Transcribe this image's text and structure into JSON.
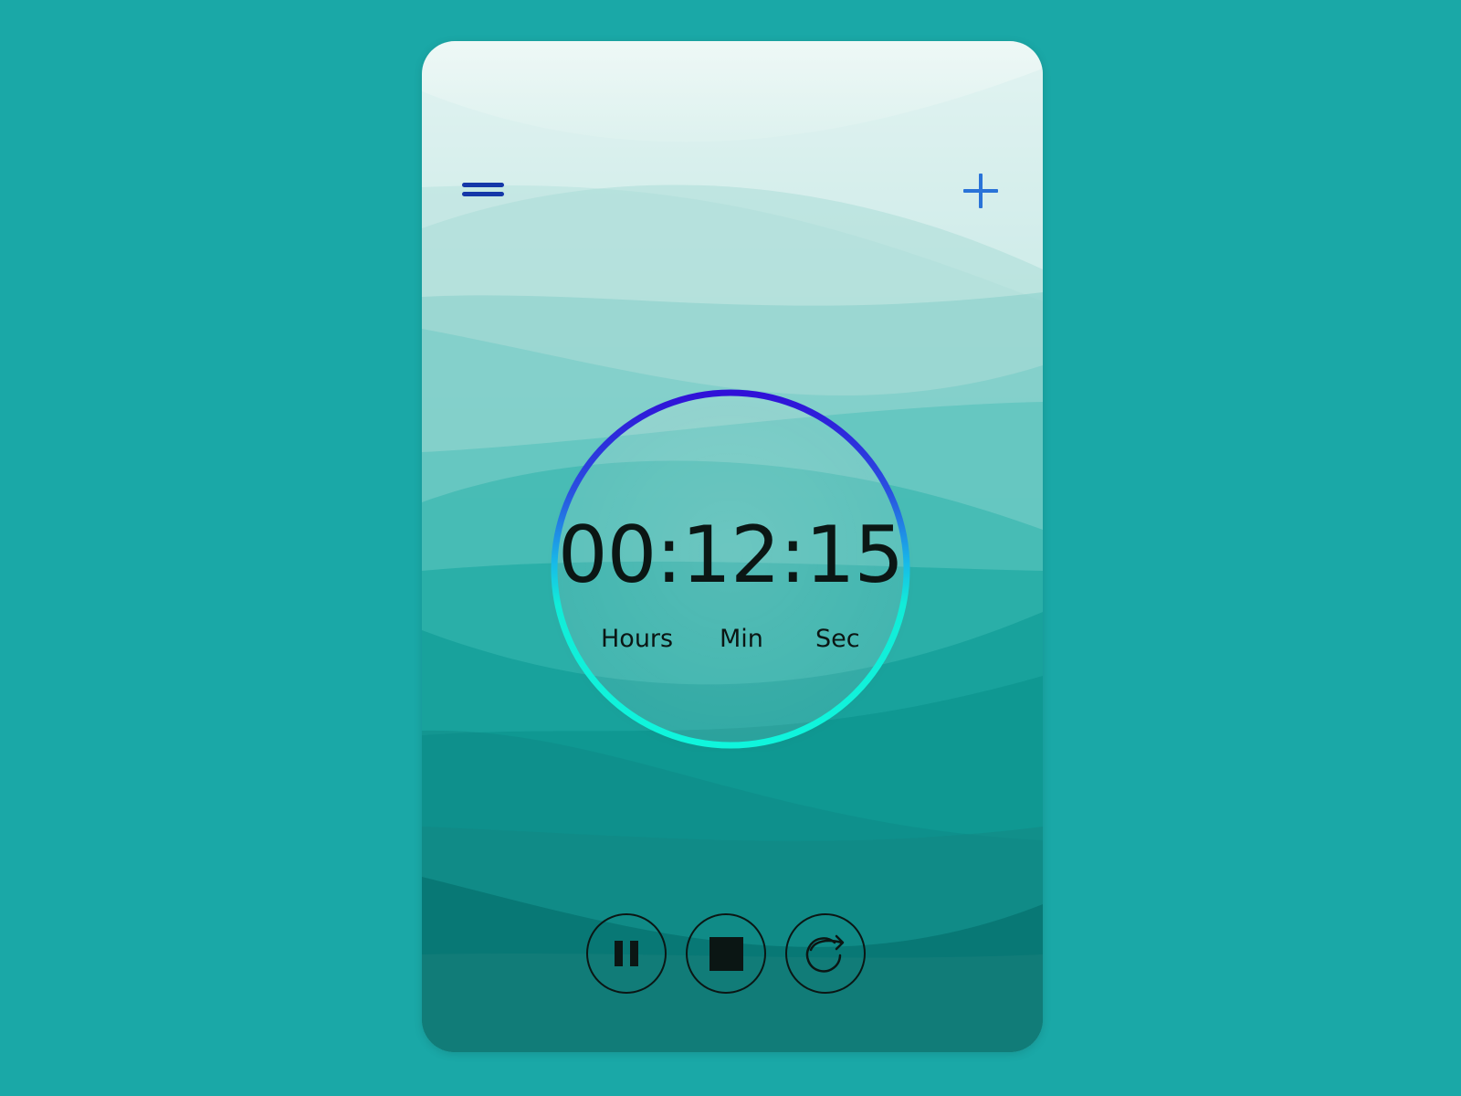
{
  "app": {
    "background_color": "#1aa8a7",
    "accent_colors": {
      "menu": "#1437a8",
      "add": "#2a73d8",
      "ring_top": "#3010d8",
      "ring_bottom": "#10f5dc"
    }
  },
  "header": {
    "menu_icon": "hamburger-menu-icon",
    "add_icon": "plus-icon"
  },
  "timer": {
    "display": "00:12:15",
    "hours": "00",
    "minutes": "12",
    "seconds": "15",
    "units": {
      "hours": "Hours",
      "minutes": "Min",
      "seconds": "Sec"
    }
  },
  "controls": [
    {
      "icon": "pause-icon"
    },
    {
      "icon": "stop-icon"
    },
    {
      "icon": "restart-icon"
    }
  ]
}
